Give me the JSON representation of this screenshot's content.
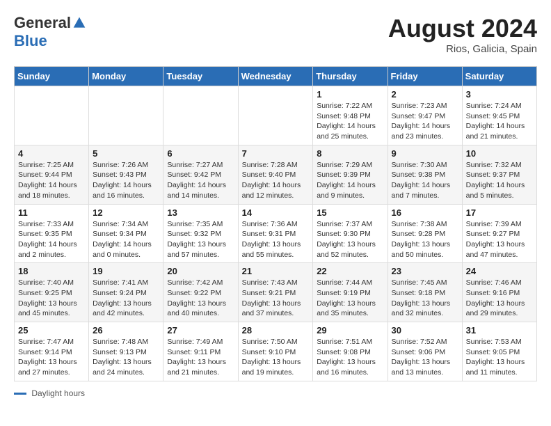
{
  "header": {
    "logo_general": "General",
    "logo_blue": "Blue",
    "month_year": "August 2024",
    "location": "Rios, Galicia, Spain"
  },
  "days_of_week": [
    "Sunday",
    "Monday",
    "Tuesday",
    "Wednesday",
    "Thursday",
    "Friday",
    "Saturday"
  ],
  "weeks": [
    [
      {
        "day": "",
        "info": ""
      },
      {
        "day": "",
        "info": ""
      },
      {
        "day": "",
        "info": ""
      },
      {
        "day": "",
        "info": ""
      },
      {
        "day": "1",
        "info": "Sunrise: 7:22 AM\nSunset: 9:48 PM\nDaylight: 14 hours and 25 minutes."
      },
      {
        "day": "2",
        "info": "Sunrise: 7:23 AM\nSunset: 9:47 PM\nDaylight: 14 hours and 23 minutes."
      },
      {
        "day": "3",
        "info": "Sunrise: 7:24 AM\nSunset: 9:45 PM\nDaylight: 14 hours and 21 minutes."
      }
    ],
    [
      {
        "day": "4",
        "info": "Sunrise: 7:25 AM\nSunset: 9:44 PM\nDaylight: 14 hours and 18 minutes."
      },
      {
        "day": "5",
        "info": "Sunrise: 7:26 AM\nSunset: 9:43 PM\nDaylight: 14 hours and 16 minutes."
      },
      {
        "day": "6",
        "info": "Sunrise: 7:27 AM\nSunset: 9:42 PM\nDaylight: 14 hours and 14 minutes."
      },
      {
        "day": "7",
        "info": "Sunrise: 7:28 AM\nSunset: 9:40 PM\nDaylight: 14 hours and 12 minutes."
      },
      {
        "day": "8",
        "info": "Sunrise: 7:29 AM\nSunset: 9:39 PM\nDaylight: 14 hours and 9 minutes."
      },
      {
        "day": "9",
        "info": "Sunrise: 7:30 AM\nSunset: 9:38 PM\nDaylight: 14 hours and 7 minutes."
      },
      {
        "day": "10",
        "info": "Sunrise: 7:32 AM\nSunset: 9:37 PM\nDaylight: 14 hours and 5 minutes."
      }
    ],
    [
      {
        "day": "11",
        "info": "Sunrise: 7:33 AM\nSunset: 9:35 PM\nDaylight: 14 hours and 2 minutes."
      },
      {
        "day": "12",
        "info": "Sunrise: 7:34 AM\nSunset: 9:34 PM\nDaylight: 14 hours and 0 minutes."
      },
      {
        "day": "13",
        "info": "Sunrise: 7:35 AM\nSunset: 9:32 PM\nDaylight: 13 hours and 57 minutes."
      },
      {
        "day": "14",
        "info": "Sunrise: 7:36 AM\nSunset: 9:31 PM\nDaylight: 13 hours and 55 minutes."
      },
      {
        "day": "15",
        "info": "Sunrise: 7:37 AM\nSunset: 9:30 PM\nDaylight: 13 hours and 52 minutes."
      },
      {
        "day": "16",
        "info": "Sunrise: 7:38 AM\nSunset: 9:28 PM\nDaylight: 13 hours and 50 minutes."
      },
      {
        "day": "17",
        "info": "Sunrise: 7:39 AM\nSunset: 9:27 PM\nDaylight: 13 hours and 47 minutes."
      }
    ],
    [
      {
        "day": "18",
        "info": "Sunrise: 7:40 AM\nSunset: 9:25 PM\nDaylight: 13 hours and 45 minutes."
      },
      {
        "day": "19",
        "info": "Sunrise: 7:41 AM\nSunset: 9:24 PM\nDaylight: 13 hours and 42 minutes."
      },
      {
        "day": "20",
        "info": "Sunrise: 7:42 AM\nSunset: 9:22 PM\nDaylight: 13 hours and 40 minutes."
      },
      {
        "day": "21",
        "info": "Sunrise: 7:43 AM\nSunset: 9:21 PM\nDaylight: 13 hours and 37 minutes."
      },
      {
        "day": "22",
        "info": "Sunrise: 7:44 AM\nSunset: 9:19 PM\nDaylight: 13 hours and 35 minutes."
      },
      {
        "day": "23",
        "info": "Sunrise: 7:45 AM\nSunset: 9:18 PM\nDaylight: 13 hours and 32 minutes."
      },
      {
        "day": "24",
        "info": "Sunrise: 7:46 AM\nSunset: 9:16 PM\nDaylight: 13 hours and 29 minutes."
      }
    ],
    [
      {
        "day": "25",
        "info": "Sunrise: 7:47 AM\nSunset: 9:14 PM\nDaylight: 13 hours and 27 minutes."
      },
      {
        "day": "26",
        "info": "Sunrise: 7:48 AM\nSunset: 9:13 PM\nDaylight: 13 hours and 24 minutes."
      },
      {
        "day": "27",
        "info": "Sunrise: 7:49 AM\nSunset: 9:11 PM\nDaylight: 13 hours and 21 minutes."
      },
      {
        "day": "28",
        "info": "Sunrise: 7:50 AM\nSunset: 9:10 PM\nDaylight: 13 hours and 19 minutes."
      },
      {
        "day": "29",
        "info": "Sunrise: 7:51 AM\nSunset: 9:08 PM\nDaylight: 13 hours and 16 minutes."
      },
      {
        "day": "30",
        "info": "Sunrise: 7:52 AM\nSunset: 9:06 PM\nDaylight: 13 hours and 13 minutes."
      },
      {
        "day": "31",
        "info": "Sunrise: 7:53 AM\nSunset: 9:05 PM\nDaylight: 13 hours and 11 minutes."
      }
    ]
  ],
  "footer": {
    "label": "Daylight hours"
  }
}
